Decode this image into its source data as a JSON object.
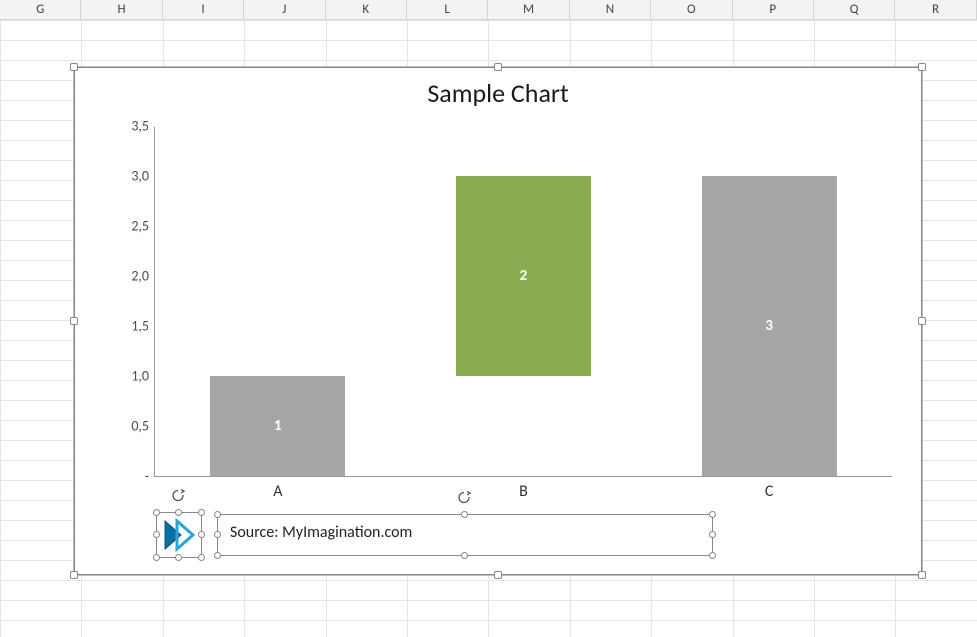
{
  "columns": [
    "G",
    "H",
    "I",
    "J",
    "K",
    "L",
    "M",
    "N",
    "O",
    "P",
    "Q",
    "R"
  ],
  "chart_data": {
    "type": "bar",
    "title": "Sample Chart",
    "categories": [
      "A",
      "B",
      "C"
    ],
    "series": [
      {
        "name": "1",
        "values": [
          1.0,
          null,
          null
        ],
        "color": "#a6a6a6"
      },
      {
        "name": "2",
        "values": [
          null,
          2.0,
          null
        ],
        "color": "#8aad51",
        "y_offset": 1.0
      },
      {
        "name": "3",
        "values": [
          null,
          null,
          3.0
        ],
        "color": "#a6a6a6"
      }
    ],
    "data_labels": [
      "1",
      "2",
      "3"
    ],
    "y_ticks": [
      "-",
      "0,5",
      "1,0",
      "1,5",
      "2,0",
      "2,5",
      "3,0",
      "3,5"
    ],
    "ylim": [
      0,
      3.5
    ],
    "xlabel": "",
    "ylabel": ""
  },
  "source_note": "Source: MyImagination.com",
  "logo_name": "arrow-shape-icon"
}
